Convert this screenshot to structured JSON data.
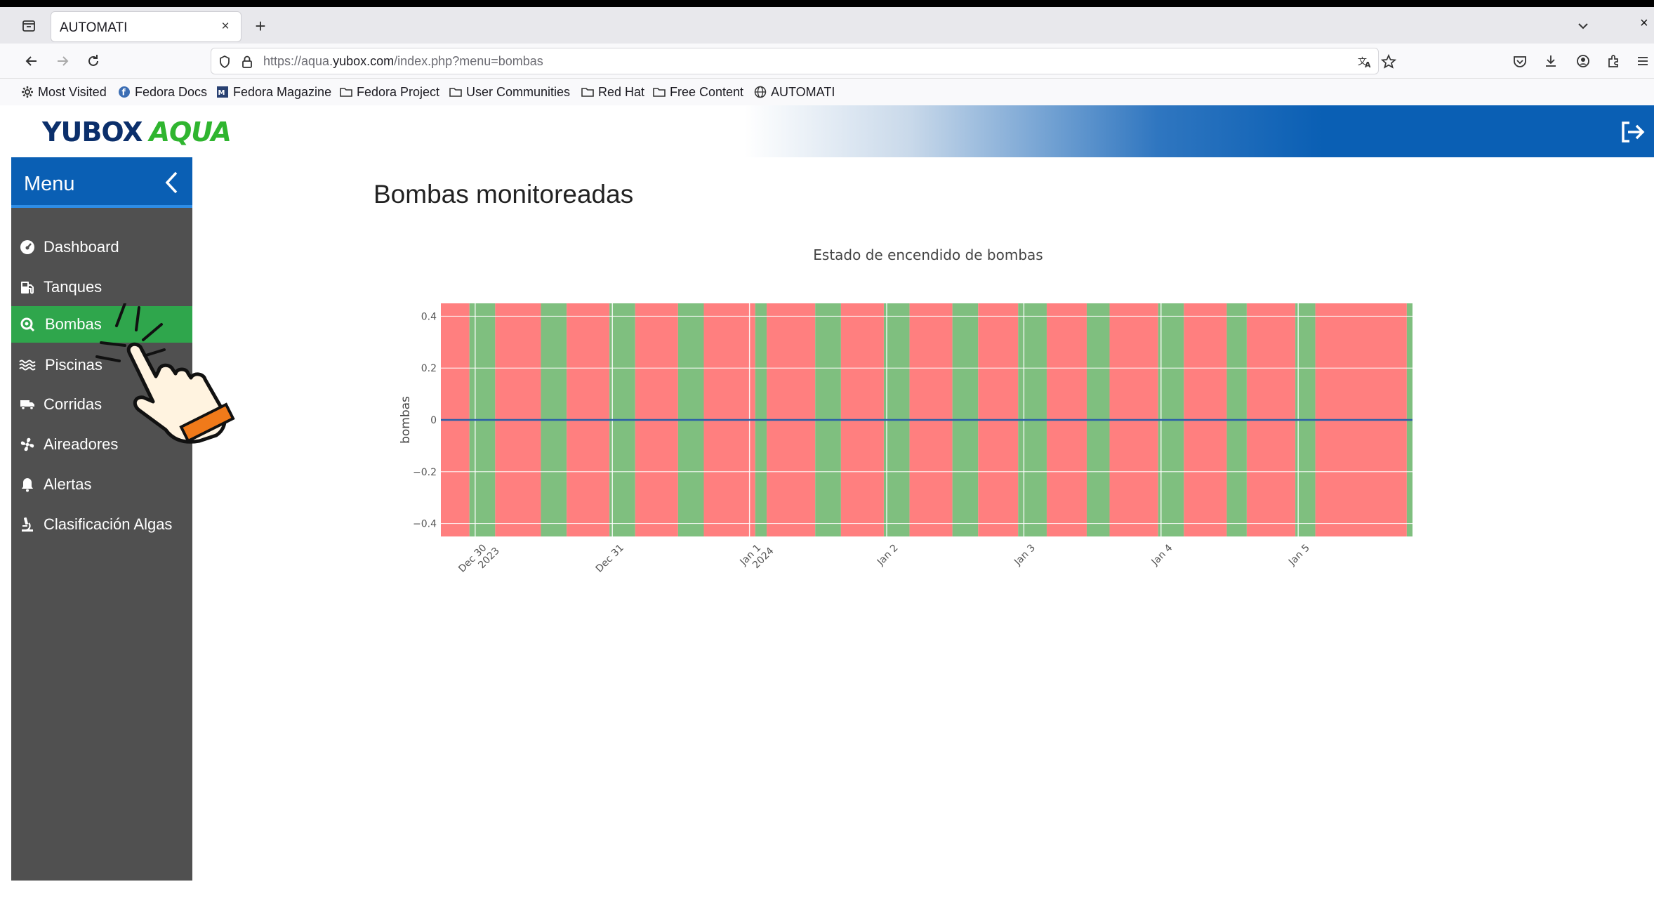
{
  "browser": {
    "tab_title": "AUTOMATI",
    "tab_close": "×",
    "new_tab": "+",
    "window_close": "×",
    "url_prefix": "https://aqua.",
    "url_domain": "yubox.com",
    "url_path": "/index.php?menu=bombas",
    "bookmarks": [
      {
        "label": "Most Visited",
        "icon": "gear-icon"
      },
      {
        "label": "Fedora Docs",
        "icon": "fedora-icon"
      },
      {
        "label": "Fedora Magazine",
        "icon": "magazine-icon"
      },
      {
        "label": "Fedora Project",
        "icon": "folder-icon"
      },
      {
        "label": "User Communities",
        "icon": "folder-icon"
      },
      {
        "label": "Red Hat",
        "icon": "folder-icon"
      },
      {
        "label": "Free Content",
        "icon": "folder-icon"
      },
      {
        "label": "AUTOMATI",
        "icon": "globe-icon"
      }
    ]
  },
  "app": {
    "logo_main": "YUBOX",
    "logo_accent": "AQUA",
    "menu_title": "Menu",
    "sidebar": [
      {
        "label": "Dashboard",
        "icon": "dashboard-icon",
        "active": false
      },
      {
        "label": "Tanques",
        "icon": "fuel-tank-icon",
        "active": false
      },
      {
        "label": "Bombas",
        "icon": "pump-search-icon",
        "active": true
      },
      {
        "label": "Piscinas",
        "icon": "water-waves-icon",
        "active": false
      },
      {
        "label": "Corridas",
        "icon": "truck-icon",
        "active": false
      },
      {
        "label": "Aireadores",
        "icon": "fan-icon",
        "active": false
      },
      {
        "label": "Alertas",
        "icon": "bell-icon",
        "active": false
      },
      {
        "label": "Clasificación Algas",
        "icon": "microscope-icon",
        "active": false
      }
    ],
    "page_title": "Bombas monitoreadas"
  },
  "chart_data": {
    "type": "area",
    "title": "Estado de encendido de bombas",
    "xlabel": "",
    "ylabel": "bombas",
    "ylim": [
      -0.45,
      0.45
    ],
    "yticks": [
      0.4,
      0.2,
      0,
      -0.2,
      -0.4
    ],
    "ytick_labels": [
      "0.4",
      "0.2",
      "0",
      "−0.2",
      "−0.4"
    ],
    "x_range": [
      "2023-12-29 18:00",
      "2024-01-05 20:00"
    ],
    "x_ticks": [
      {
        "t": "2023-12-30 00:00",
        "lines": [
          "Dec 30",
          "2023"
        ]
      },
      {
        "t": "2023-12-31 00:00",
        "lines": [
          "Dec 31"
        ]
      },
      {
        "t": "2024-01-01 00:00",
        "lines": [
          "Jan 1",
          "2024"
        ]
      },
      {
        "t": "2024-01-02 00:00",
        "lines": [
          "Jan 2"
        ]
      },
      {
        "t": "2024-01-03 00:00",
        "lines": [
          "Jan 3"
        ]
      },
      {
        "t": "2024-01-04 00:00",
        "lines": [
          "Jan 4"
        ]
      },
      {
        "t": "2024-01-05 00:00",
        "lines": [
          "Jan 5"
        ]
      }
    ],
    "colors": {
      "off": "#ff7f7f",
      "on": "#7fbf7f",
      "line": "#2a5fa8",
      "grid": "#ffffff"
    },
    "series": [
      {
        "values": [
          0,
          0
        ]
      }
    ],
    "line_x": [
      "2023-12-29 18:00",
      "2024-01-05 20:00"
    ],
    "state_intervals": [
      {
        "start": "2023-12-29 18:00",
        "end": "2023-12-29 23:00",
        "state": "off"
      },
      {
        "start": "2023-12-29 23:00",
        "end": "2023-12-30 03:30",
        "state": "on"
      },
      {
        "start": "2023-12-30 03:30",
        "end": "2023-12-30 11:30",
        "state": "off"
      },
      {
        "start": "2023-12-30 11:30",
        "end": "2023-12-30 16:00",
        "state": "on"
      },
      {
        "start": "2023-12-30 16:00",
        "end": "2023-12-30 23:30",
        "state": "off"
      },
      {
        "start": "2023-12-30 23:30",
        "end": "2023-12-31 04:00",
        "state": "on"
      },
      {
        "start": "2023-12-31 04:00",
        "end": "2023-12-31 11:30",
        "state": "off"
      },
      {
        "start": "2023-12-31 11:30",
        "end": "2023-12-31 16:00",
        "state": "on"
      },
      {
        "start": "2023-12-31 16:00",
        "end": "2024-01-01 01:00",
        "state": "off"
      },
      {
        "start": "2024-01-01 01:00",
        "end": "2024-01-01 03:00",
        "state": "on"
      },
      {
        "start": "2024-01-01 03:00",
        "end": "2024-01-01 11:30",
        "state": "off"
      },
      {
        "start": "2024-01-01 11:30",
        "end": "2024-01-01 16:00",
        "state": "on"
      },
      {
        "start": "2024-01-01 16:00",
        "end": "2024-01-01 23:30",
        "state": "off"
      },
      {
        "start": "2024-01-01 23:30",
        "end": "2024-01-02 04:00",
        "state": "on"
      },
      {
        "start": "2024-01-02 04:00",
        "end": "2024-01-02 11:30",
        "state": "off"
      },
      {
        "start": "2024-01-02 11:30",
        "end": "2024-01-02 16:00",
        "state": "on"
      },
      {
        "start": "2024-01-02 16:00",
        "end": "2024-01-02 23:00",
        "state": "off"
      },
      {
        "start": "2024-01-02 23:00",
        "end": "2024-01-03 04:00",
        "state": "on"
      },
      {
        "start": "2024-01-03 04:00",
        "end": "2024-01-03 11:00",
        "state": "off"
      },
      {
        "start": "2024-01-03 11:00",
        "end": "2024-01-03 15:00",
        "state": "on"
      },
      {
        "start": "2024-01-03 15:00",
        "end": "2024-01-03 23:30",
        "state": "off"
      },
      {
        "start": "2024-01-03 23:30",
        "end": "2024-01-04 04:00",
        "state": "on"
      },
      {
        "start": "2024-01-04 04:00",
        "end": "2024-01-04 11:30",
        "state": "off"
      },
      {
        "start": "2024-01-04 11:30",
        "end": "2024-01-04 15:00",
        "state": "on"
      },
      {
        "start": "2024-01-04 15:00",
        "end": "2024-01-04 23:30",
        "state": "off"
      },
      {
        "start": "2024-01-04 23:30",
        "end": "2024-01-05 03:00",
        "state": "on"
      },
      {
        "start": "2024-01-05 03:00",
        "end": "2024-01-05 19:00",
        "state": "off"
      },
      {
        "start": "2024-01-05 19:00",
        "end": "2024-01-05 20:00",
        "state": "on"
      }
    ]
  }
}
